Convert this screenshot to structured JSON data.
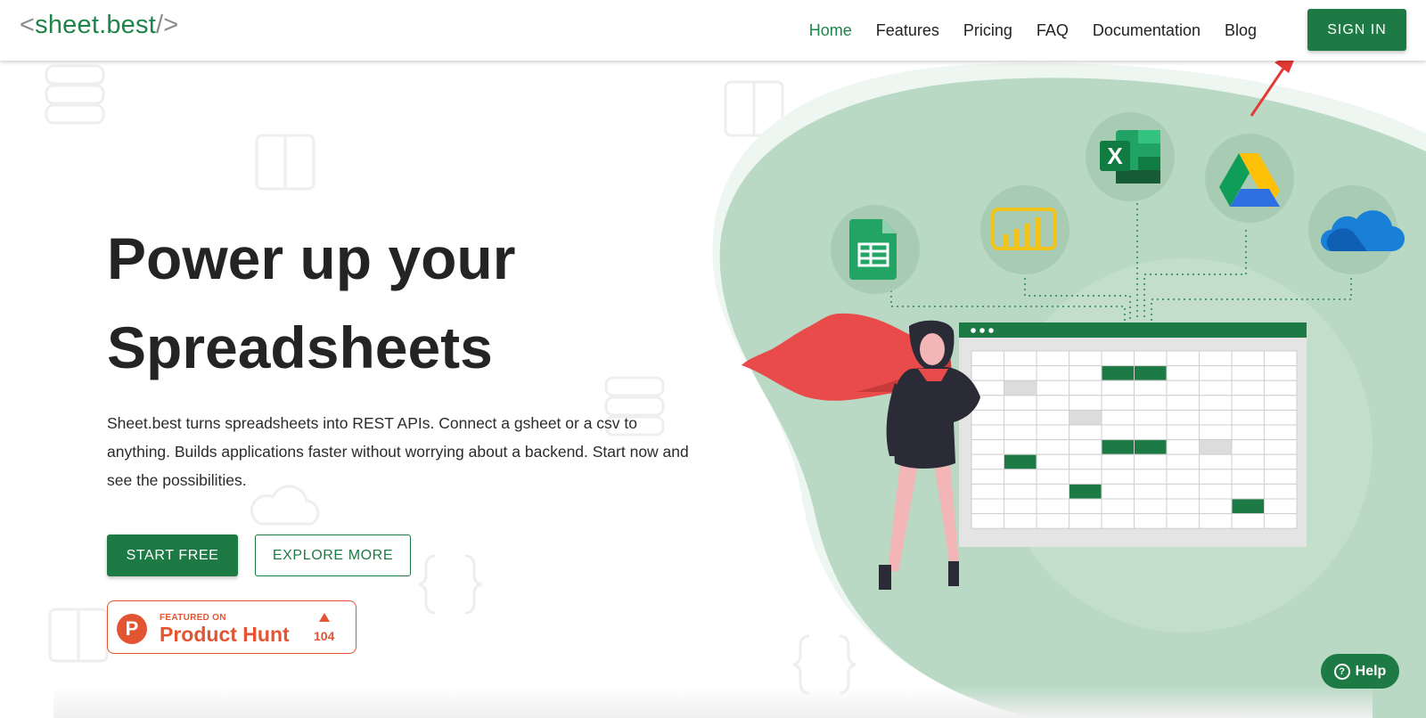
{
  "header": {
    "logo_open": "<",
    "logo_text": "sheet.best",
    "logo_close": "/>",
    "nav": [
      {
        "label": "Home",
        "active": true
      },
      {
        "label": "Features"
      },
      {
        "label": "Pricing"
      },
      {
        "label": "FAQ"
      },
      {
        "label": "Documentation"
      },
      {
        "label": "Blog"
      }
    ],
    "signin_label": "SIGN IN"
  },
  "hero": {
    "title_line1": "Power up your",
    "title_line2": "Spreadsheets",
    "description": "Sheet.best turns spreadsheets into REST APIs. Connect a gsheet or a csv to anything. Builds applications faster without worrying about a backend. Start now and see the possibilities.",
    "start_label": "START FREE",
    "explore_label": "EXPLORE MORE"
  },
  "product_hunt": {
    "logo_letter": "P",
    "featured": "FEATURED ON",
    "name": "Product Hunt",
    "count": "104"
  },
  "illustration": {
    "icons": [
      "google-sheets-icon",
      "power-bi-icon",
      "excel-icon",
      "google-drive-icon",
      "onedrive-icon"
    ],
    "excel_letter": "X"
  },
  "help_label": "Help",
  "help_icon": "?",
  "colors": {
    "brand_green": "#1e7a44",
    "blob": "#b8d8c3",
    "product_hunt": "#e35532",
    "cape": "#e94b4b"
  }
}
